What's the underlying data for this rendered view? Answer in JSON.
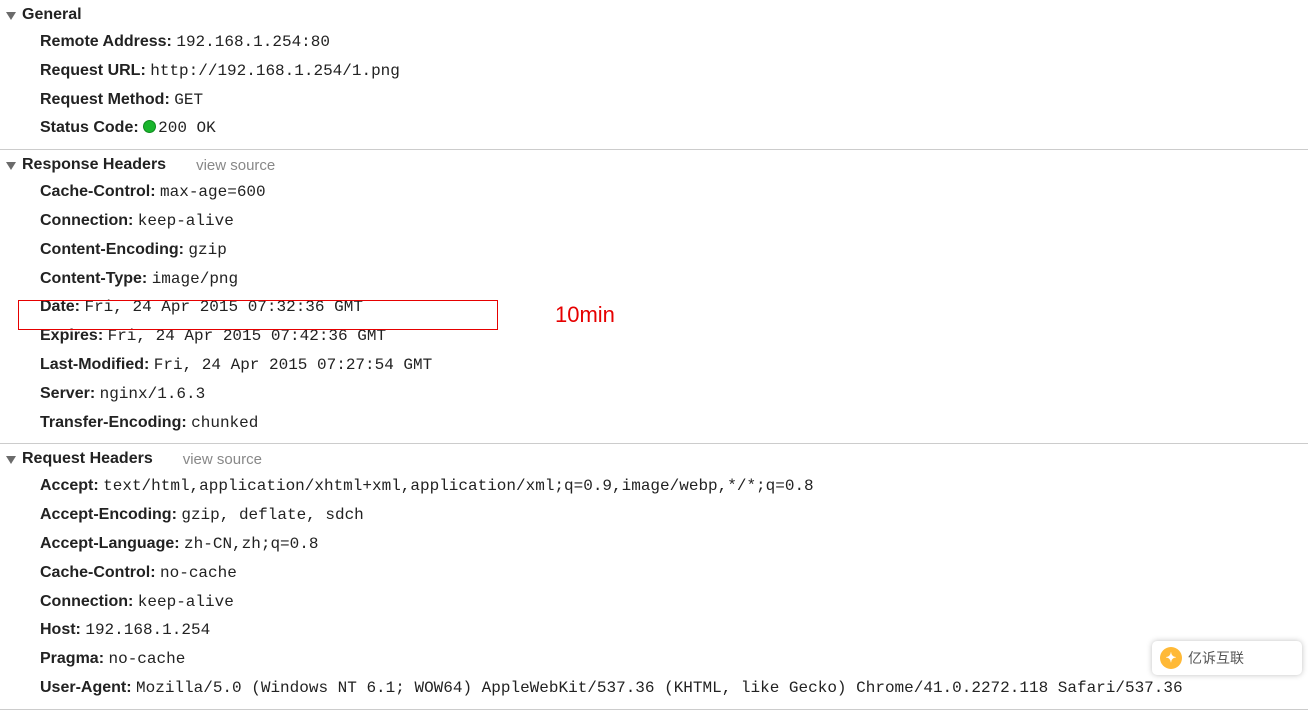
{
  "annotation": {
    "label": "10min"
  },
  "sections": {
    "general": {
      "title": "General",
      "items": [
        {
          "k": "Remote Address:",
          "v": "192.168.1.254:80"
        },
        {
          "k": "Request URL:",
          "v": "http://192.168.1.254/1.png"
        },
        {
          "k": "Request Method:",
          "v": "GET"
        },
        {
          "k": "Status Code:",
          "v": "200 OK",
          "status_dot": true
        }
      ]
    },
    "response": {
      "title": "Response Headers",
      "view_source": "view source",
      "items": [
        {
          "k": "Cache-Control:",
          "v": "max-age=600"
        },
        {
          "k": "Connection:",
          "v": "keep-alive"
        },
        {
          "k": "Content-Encoding:",
          "v": "gzip"
        },
        {
          "k": "Content-Type:",
          "v": "image/png"
        },
        {
          "k": "Date:",
          "v": "Fri, 24 Apr 2015 07:32:36 GMT"
        },
        {
          "k": "Expires:",
          "v": "Fri, 24 Apr 2015 07:42:36 GMT"
        },
        {
          "k": "Last-Modified:",
          "v": "Fri, 24 Apr 2015 07:27:54 GMT"
        },
        {
          "k": "Server:",
          "v": "nginx/1.6.3"
        },
        {
          "k": "Transfer-Encoding:",
          "v": "chunked"
        }
      ]
    },
    "request": {
      "title": "Request Headers",
      "view_source": "view source",
      "items": [
        {
          "k": "Accept:",
          "v": "text/html,application/xhtml+xml,application/xml;q=0.9,image/webp,*/*;q=0.8"
        },
        {
          "k": "Accept-Encoding:",
          "v": "gzip, deflate, sdch"
        },
        {
          "k": "Accept-Language:",
          "v": "zh-CN,zh;q=0.8"
        },
        {
          "k": "Cache-Control:",
          "v": "no-cache"
        },
        {
          "k": "Connection:",
          "v": "keep-alive"
        },
        {
          "k": "Host:",
          "v": "192.168.1.254"
        },
        {
          "k": "Pragma:",
          "v": "no-cache"
        },
        {
          "k": "User-Agent:",
          "v": "Mozilla/5.0 (Windows NT 6.1; WOW64) AppleWebKit/537.36 (KHTML, like Gecko) Chrome/41.0.2272.118 Safari/537.36"
        }
      ]
    }
  },
  "badge": {
    "text": "亿诉互联"
  }
}
